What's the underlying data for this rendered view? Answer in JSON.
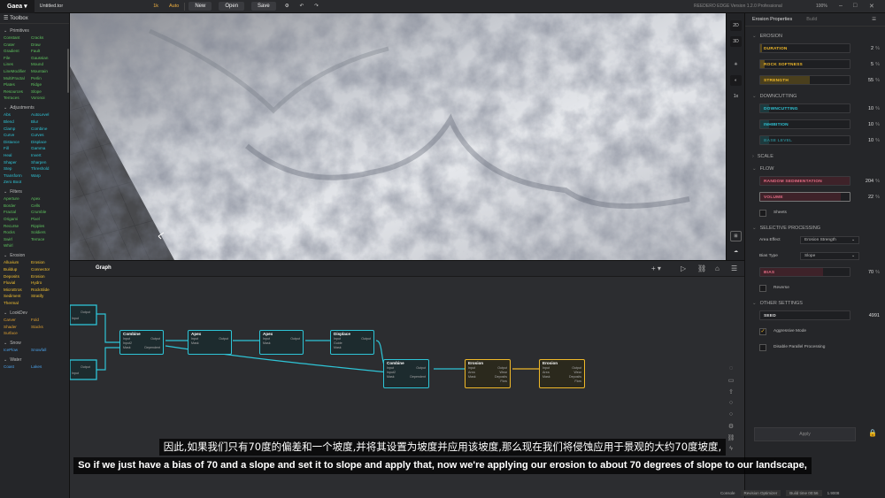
{
  "topbar": {
    "logo": "Gaea",
    "file": "Untitled.tor",
    "resolution": "1k",
    "build_mode": "Auto",
    "new_label": "New",
    "open_label": "Open",
    "save_label": "Save",
    "version": "REEDERO EDGE Version 1.2.0 Professional",
    "zoom": "100%"
  },
  "toolbox": {
    "title": "Toolbox",
    "categories": [
      {
        "name": "Primitives",
        "color": "#5ec25e",
        "items": [
          "Constant",
          "Cracks",
          "Crater",
          "Draw",
          "Gradient",
          "Fault",
          "File",
          "Gaussian",
          "Lines",
          "Mound",
          "LineModifier",
          "Mountain",
          "MultiFractal",
          "Perlin",
          "Plates",
          "Ridge",
          "Resources",
          "Slope",
          "Terraces",
          "Voronoi"
        ]
      },
      {
        "name": "Adjustments",
        "color": "#2ec4d6",
        "items": [
          "Abs",
          "AutoLevel",
          "Blend",
          "Blur",
          "Clamp",
          "Combine",
          "Curve",
          "Curves",
          "Distance",
          "Displace",
          "Fill",
          "Gamma",
          "Heal",
          "Invert",
          "Shaper",
          "Sharpen",
          "Step",
          "Threshold",
          "Transform",
          "Warp",
          "Zero Boot"
        ]
      },
      {
        "name": "Filters",
        "color": "#5ec25e",
        "items": [
          "Aperture",
          "Apex",
          "Border",
          "Cells",
          "Fractal",
          "Crumble",
          "Origami",
          "Pixel",
          "Recurse",
          "Ripples",
          "Rocks",
          "Soldiers",
          "Swirl",
          "Terrace",
          "Whirl"
        ]
      },
      {
        "name": "Erosion",
        "color": "#f2c030",
        "items": [
          "Alluvium",
          "Erosion",
          "Buildup",
          "Connector",
          "Deposits",
          "Erosion",
          "Fluvial",
          "Hydro",
          "MicroEros",
          "RockSlide",
          "Sediment",
          "Stratify",
          "Thermal"
        ]
      },
      {
        "name": "LookDev",
        "color": "#e0a030",
        "items": [
          "Carver",
          "Fold",
          "Shader",
          "Stacks",
          "Surface"
        ]
      },
      {
        "name": "Snow",
        "color": "#4aa0e8",
        "items": [
          "IcePlow",
          "Snowfall"
        ]
      },
      {
        "name": "Water",
        "color": "#4aa0e8",
        "items": [
          "Coast",
          "Lakes"
        ]
      }
    ]
  },
  "viewport": {
    "btn_2d": "2D",
    "btn_3d": "3D",
    "btn_1x": "1x"
  },
  "graph": {
    "title": "Graph",
    "nodes": [
      {
        "title": "Combine",
        "rows": [
          [
            "Input",
            "Output"
          ],
          [
            "Input2",
            ""
          ],
          [
            "Mask",
            "Dependent"
          ]
        ]
      },
      {
        "title": "Apex",
        "rows": [
          [
            "Input",
            "Output"
          ],
          [
            "Mask",
            ""
          ]
        ]
      },
      {
        "title": "Apex",
        "rows": [
          [
            "Input",
            "Output"
          ],
          [
            "Mask",
            ""
          ]
        ]
      },
      {
        "title": "Displace",
        "rows": [
          [
            "Input",
            "Output"
          ],
          [
            "Guide",
            ""
          ],
          [
            "Mask",
            ""
          ]
        ]
      },
      {
        "title": "Combine",
        "rows": [
          [
            "Input",
            "Output"
          ],
          [
            "Input2",
            ""
          ],
          [
            "Mask",
            "Dependent"
          ]
        ]
      },
      {
        "title": "Erosion",
        "rows": [
          [
            "Input",
            "Output"
          ],
          [
            "Area",
            "Wear"
          ],
          [
            "Mask",
            "Deposits"
          ],
          [
            "",
            "Flow"
          ]
        ]
      },
      {
        "title": "Erosion",
        "rows": [
          [
            "Input",
            "Output"
          ],
          [
            "Area",
            "Wear"
          ],
          [
            "Mask",
            "Deposits"
          ],
          [
            "",
            "Flow"
          ]
        ]
      }
    ],
    "stub_labels": [
      "Output",
      "Input",
      "Output",
      "Input"
    ]
  },
  "props": {
    "tab_active": "Erosion Properties",
    "tab_other": "Build",
    "sections": {
      "erosion": "EROSION",
      "downcutting": "DOWNCUTTING",
      "scale": "SCALE",
      "flow": "FLOW",
      "selective": "SELECTIVE PROCESSING",
      "other": "OTHER SETTINGS"
    },
    "duration": {
      "label": "DURATION",
      "value": "2",
      "unit": "%",
      "fill": 0.02
    },
    "rock_softness": {
      "label": "ROCK SOFTNESS",
      "value": "5",
      "unit": "%",
      "fill": 0.05
    },
    "strength": {
      "label": "STRENGTH",
      "value": "55",
      "unit": "%",
      "fill": 0.55
    },
    "downcutting": {
      "label": "DOWNCUTTING",
      "value": "10",
      "unit": "%",
      "fill": 0.1
    },
    "inhibition": {
      "label": "INHIBITION",
      "value": "10",
      "unit": "%",
      "fill": 0.1
    },
    "base_level": {
      "label": "BASE LEVEL",
      "value": "10",
      "unit": "%",
      "fill": 0.1
    },
    "random_sed": {
      "label": "RANDOM SEDIMENTATION",
      "value": "204",
      "unit": "%",
      "fill": 1.0
    },
    "volume": {
      "label": "VOLUME",
      "value": "22",
      "unit": "%",
      "fill": 0.9
    },
    "sheets_label": "Sheets",
    "area_effect_label": "Area Effect",
    "area_effect_value": "Erosion Strength",
    "bias_type_label": "Bias Type",
    "bias_type_value": "Slope",
    "bias": {
      "label": "BIAS",
      "value": "70",
      "unit": "%",
      "fill": 0.7
    },
    "reverse_label": "Reverse",
    "seed": {
      "label": "SEED",
      "value": "4991"
    },
    "aggressive_label": "Aggressive Mode",
    "disable_parallel_label": "Disable Parallel Processing",
    "apply_label": "Apply"
  },
  "statusbar": {
    "console": "Console",
    "optimization": "Revision Optimizer",
    "build_time": "Build time 00:56",
    "value": "1.9008"
  },
  "subtitles": {
    "zh": "因此,如果我们只有70度的偏差和一个坡度,并将其设置为坡度并应用该坡度,那么现在我们将侵蚀应用于景观的大约70度坡度,",
    "en": "So if we just have a bias of 70 and a slope and set it to slope and apply that, now we're applying our erosion to about 70 degrees of slope to our landscape,"
  },
  "colors": {
    "accent": "#f0b929",
    "node_border": "#2ec4d6",
    "erosion_node_border": "#f0b929",
    "field_label_orange": "#f0b929",
    "field_label_pink": "#e46c84",
    "field_label_cyan": "#2ec4d6"
  }
}
